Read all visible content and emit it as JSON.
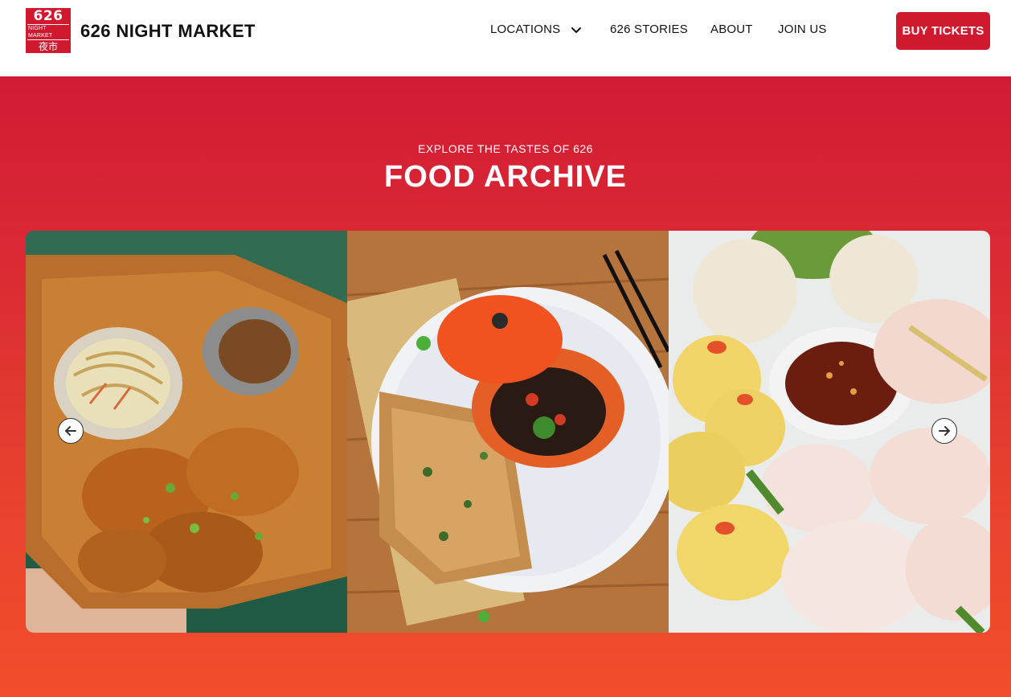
{
  "header": {
    "logo": {
      "number": "626",
      "subtitle": "NIGHT MARKET",
      "cjk": "夜市"
    },
    "brand": "626 NIGHT MARKET",
    "nav": {
      "locations": "LOCATIONS",
      "stories": "626 STORIES",
      "about": "ABOUT",
      "join": "JOIN US"
    },
    "buy_tickets": "BUY TICKETS"
  },
  "hero": {
    "eyebrow": "EXPLORE THE TASTES OF 626",
    "title": "FOOD ARCHIVE"
  },
  "carousel": {
    "slides": [
      {
        "image": "fried-chicken-and-noodle-salad-box"
      },
      {
        "image": "scallion-pancake-with-dipping-sauce"
      },
      {
        "image": "dim-sum-platter-with-chili-oil"
      }
    ],
    "prev_icon": "arrow-left-icon",
    "next_icon": "arrow-right-icon"
  },
  "colors": {
    "brand_red": "#d0182f",
    "hero_top": "#d21a35",
    "hero_bottom": "#f24d2c",
    "text_dark": "#111111",
    "white": "#ffffff"
  }
}
